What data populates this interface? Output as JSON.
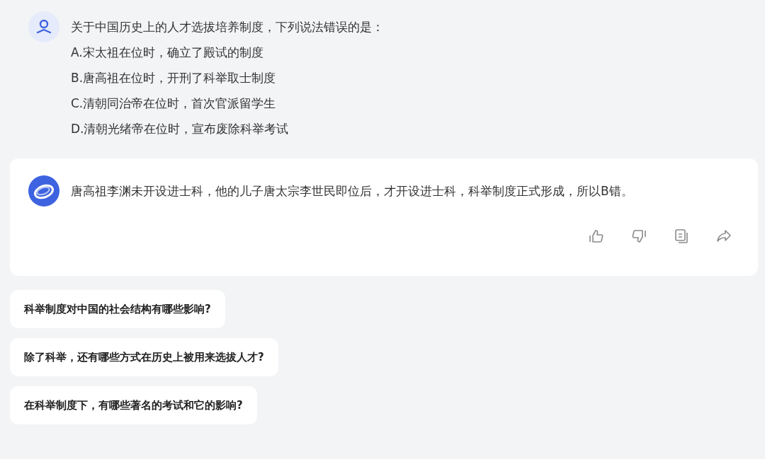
{
  "question": {
    "title": "关于中国历史上的人才选拔培养制度，下列说法错误的是：",
    "options": [
      "A.宋太祖在位时，确立了殿试的制度",
      "B.唐高祖在位时，开刑了科举取士制度",
      "C.清朝同治帝在位时，首次官派留学生",
      "D.清朝光绪帝在位时，宣布废除科举考试"
    ]
  },
  "answer": {
    "text": "唐高祖李渊未开设进士科，他的儿子唐太宗李世民即位后，才开设进士科，科举制度正式形成，所以B错。"
  },
  "suggestions": [
    "科举制度对中国的社会结构有哪些影响?",
    "除了科举，还有哪些方式在历史上被用来选拔人才?",
    "在科举制度下，有哪些著名的考试和它的影响?"
  ]
}
